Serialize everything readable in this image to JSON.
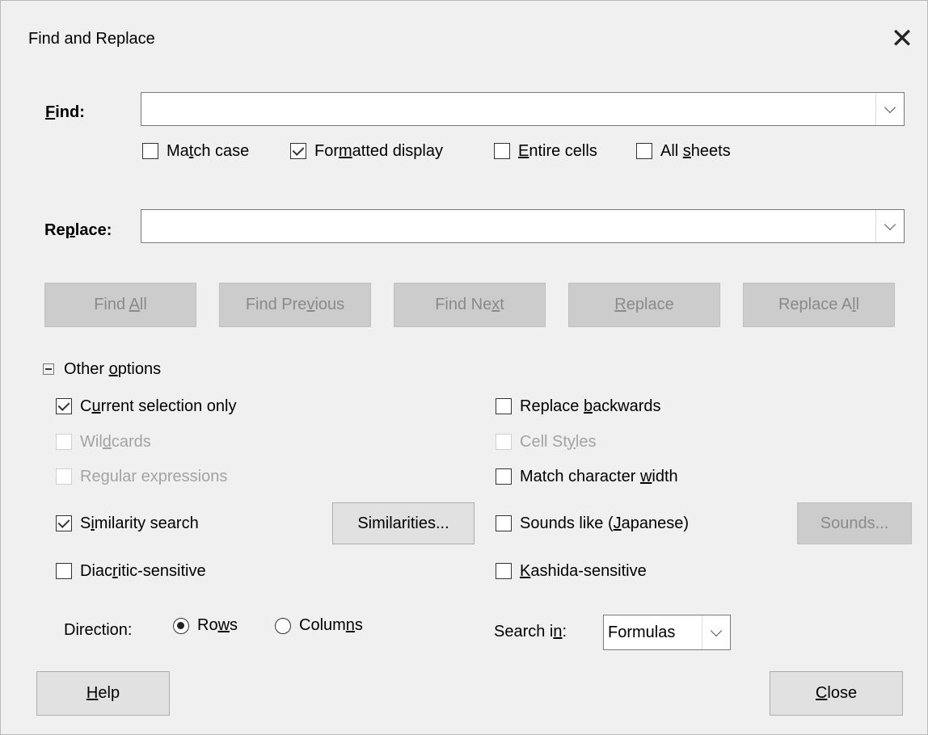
{
  "window": {
    "title": "Find and Replace"
  },
  "find": {
    "label": "Find:",
    "value": ""
  },
  "replace": {
    "label": "Replace:",
    "value": ""
  },
  "options": {
    "match_case": {
      "label": "Match case",
      "checked": false
    },
    "formatted_display": {
      "label": "Formatted display",
      "checked": true
    },
    "entire_cells": {
      "label": "Entire cells",
      "checked": false
    },
    "all_sheets": {
      "label": "All sheets",
      "checked": false
    }
  },
  "buttons": {
    "find_all": "Find All",
    "find_previous": "Find Previous",
    "find_next": "Find Next",
    "replace": "Replace",
    "replace_all": "Replace All",
    "similarities": "Similarities...",
    "sounds": "Sounds...",
    "help": "Help",
    "close": "Close"
  },
  "other_options": {
    "header": "Other options",
    "current_selection_only": {
      "label": "Current selection only",
      "checked": true
    },
    "wildcards": {
      "label": "Wildcards",
      "checked": false,
      "enabled": false
    },
    "regular_expressions": {
      "label": "Regular expressions",
      "checked": false,
      "enabled": false
    },
    "similarity_search": {
      "label": "Similarity search",
      "checked": true
    },
    "diacritic_sensitive": {
      "label": "Diacritic-sensitive",
      "checked": false
    },
    "replace_backwards": {
      "label": "Replace backwards",
      "checked": false
    },
    "cell_styles": {
      "label": "Cell Styles",
      "checked": false,
      "enabled": false
    },
    "match_character_width": {
      "label": "Match character width",
      "checked": false
    },
    "sounds_like": {
      "label": "Sounds like (Japanese)",
      "checked": false
    },
    "kashida_sensitive": {
      "label": "Kashida-sensitive",
      "checked": false
    }
  },
  "direction": {
    "label": "Direction:",
    "rows": "Rows",
    "columns": "Columns",
    "selected": "Rows"
  },
  "search_in": {
    "label": "Search in:",
    "value": "Formulas"
  }
}
